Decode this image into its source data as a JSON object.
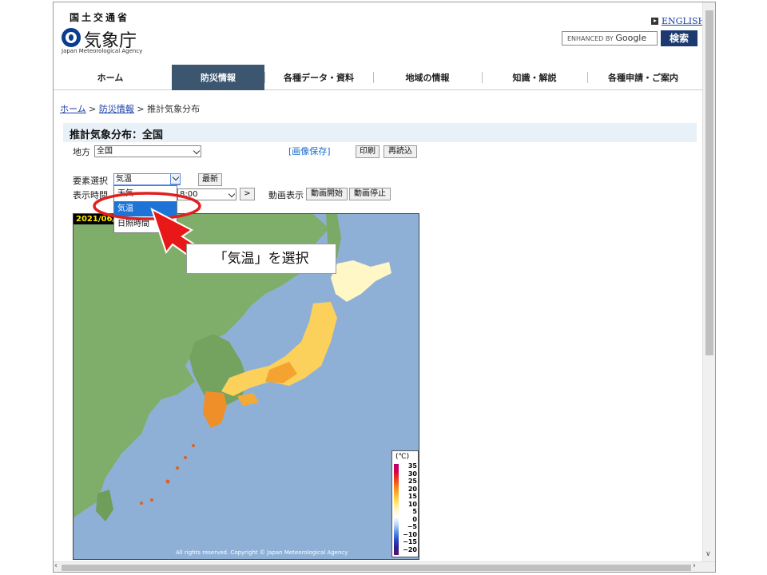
{
  "header": {
    "gov_name": "国土交通省",
    "agency_name": "気象庁",
    "agency_name_en": "Japan Meteorological Agency",
    "english_link": "ENGLISH",
    "search_placeholder_small": "ENHANCED BY",
    "search_placeholder_brand": "Google",
    "search_button": "検索"
  },
  "nav": {
    "items": [
      {
        "label": "ホーム"
      },
      {
        "label": "防災情報"
      },
      {
        "label": "各種データ・資料"
      },
      {
        "label": "地域の情報"
      },
      {
        "label": "知識・解説"
      },
      {
        "label": "各種申請・ご案内"
      }
    ],
    "active_index": 1
  },
  "breadcrumb": {
    "home": "ホーム",
    "sep": ">",
    "section": "防災情報",
    "current": "推計気象分布"
  },
  "page_title": "推計気象分布：全国",
  "controls": {
    "region_label": "地方",
    "region_value": "全国",
    "save_image": "[画像保存]",
    "print_button": "印刷",
    "reload_button": "再読込",
    "element_label": "要素選択",
    "element_value": "気温",
    "latest_button": "最新",
    "time_label": "表示時間",
    "time_value": "8:00",
    "next_button": ">",
    "animation_label": "動画表示",
    "animation_start": "動画開始",
    "animation_stop": "動画停止",
    "dropdown_options": [
      "天気",
      "気温",
      "日照時間"
    ],
    "dropdown_selected_index": 1
  },
  "map": {
    "date_stamp": "2021/06/",
    "copyright": "All rights reserved. Copyright © Japan Meteorological Agency",
    "legend_unit": "(℃)",
    "legend_ticks": [
      "35",
      "30",
      "25",
      "20",
      "15",
      "10",
      "5",
      "0",
      "−5",
      "−10",
      "−15",
      "−20"
    ],
    "legend_colors": [
      "#b4006e",
      "#d4004a",
      "#ef3a1a",
      "#f7801c",
      "#fbb72b",
      "#fde36c",
      "#fff9c0",
      "#ffffff",
      "#b9d6f5",
      "#5b92e5",
      "#2a49c9",
      "#2b1d8f",
      "#5a1466"
    ],
    "sea_color": "#8fb0d6",
    "land_color": "#6fa55f"
  },
  "annotation": {
    "callout_text": "「気温」を選択"
  }
}
